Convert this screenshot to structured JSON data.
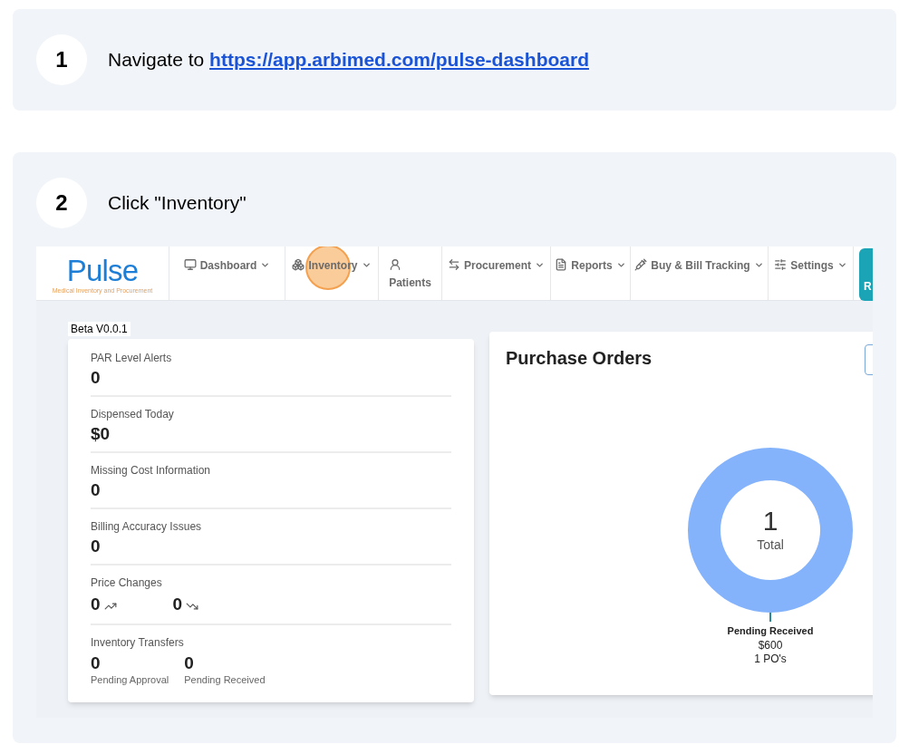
{
  "steps": [
    {
      "number": "1",
      "text": "Navigate to ",
      "link": "https://app.arbimed.com/pulse-dashboard"
    },
    {
      "number": "2",
      "text": "Click \"Inventory\""
    }
  ],
  "screenshot": {
    "logo": {
      "name": "Pulse",
      "tagline": "Medical Inventory and Procurement"
    },
    "nav": [
      {
        "kind": "monitor",
        "label": "Dashboard",
        "caret": true,
        "highlighted": false,
        "stacked": false
      },
      {
        "kind": "boxes",
        "label": "Inventory",
        "caret": true,
        "highlighted": true,
        "stacked": false
      },
      {
        "kind": "user",
        "label": "Patients",
        "caret": false,
        "highlighted": false,
        "stacked": true
      },
      {
        "kind": "arrows",
        "label": "Procurement",
        "caret": true,
        "highlighted": false,
        "stacked": false
      },
      {
        "kind": "file",
        "label": "Reports",
        "caret": true,
        "highlighted": false,
        "stacked": false
      },
      {
        "kind": "syringe",
        "label": "Buy & Bill Tracking",
        "caret": true,
        "highlighted": false,
        "stacked": false
      },
      {
        "kind": "sliders",
        "label": "Settings",
        "caret": true,
        "highlighted": false,
        "stacked": false
      }
    ],
    "cut_button": {
      "label": "R"
    },
    "version": "Beta V0.0.1",
    "stats": [
      {
        "kind": "single",
        "title": "PAR Level Alerts",
        "value": "0"
      },
      {
        "kind": "single",
        "title": "Dispensed Today",
        "value": "$0"
      },
      {
        "kind": "single",
        "title": "Missing Cost Information",
        "value": "0"
      },
      {
        "kind": "single",
        "title": "Billing Accuracy Issues",
        "value": "0"
      },
      {
        "kind": "trend",
        "title": "Price Changes",
        "items": [
          {
            "value": "0",
            "kind": "up"
          },
          {
            "value": "0",
            "kind": "down"
          }
        ]
      },
      {
        "kind": "pair",
        "title": "Inventory Transfers",
        "items": [
          {
            "value": "0",
            "caption": "Pending Approval"
          },
          {
            "value": "0",
            "caption": "Pending Received"
          }
        ]
      }
    ],
    "purchase_orders": {
      "title": "Purchase Orders",
      "center_value": "1",
      "center_label": "Total",
      "slice_label": {
        "name": "Pending Received",
        "amount": "$600",
        "count": "1 PO's"
      }
    }
  }
}
